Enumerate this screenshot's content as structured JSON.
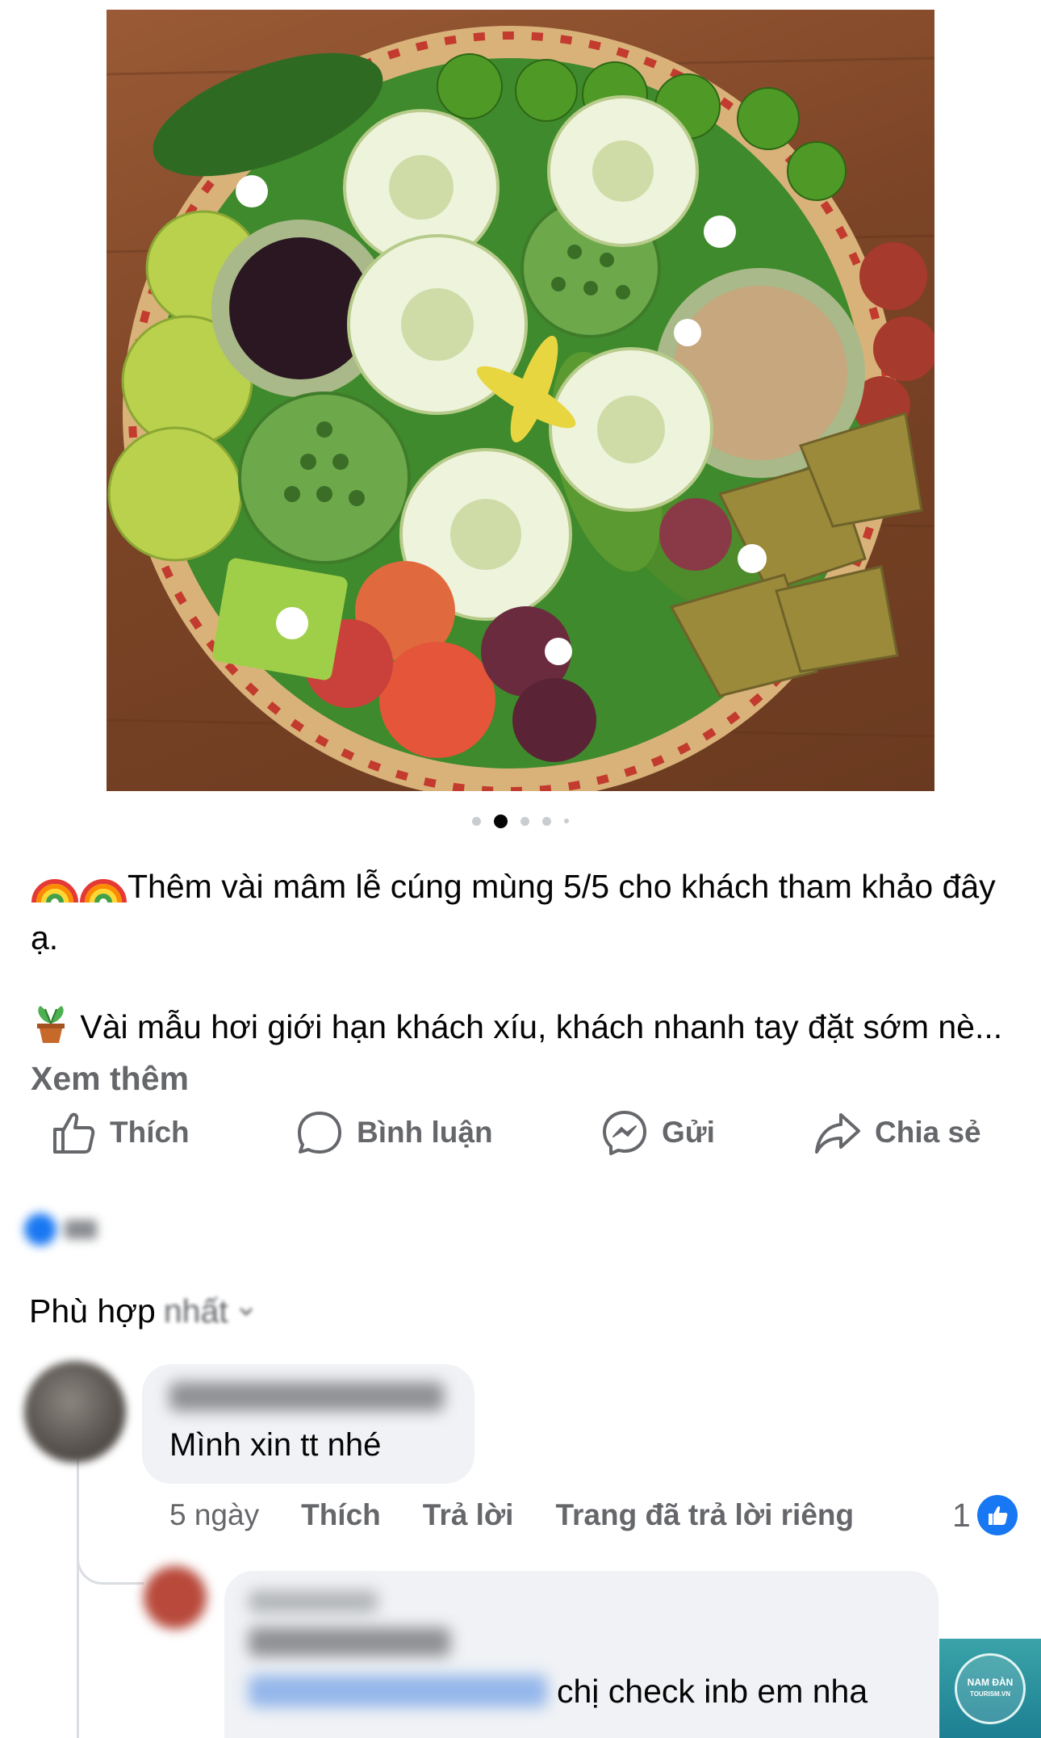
{
  "post": {
    "image_alt": "",
    "carousel": {
      "count": 5,
      "active_index": 1
    },
    "caption_line1": "Thêm vài mâm lễ cúng mùng 5/5 cho khách tham khảo đây ạ.",
    "caption_line2": "Vài mẫu hơi giới hạn khách xíu, khách nhanh tay đặt sớm nè...",
    "see_more": "Xem thêm",
    "emojis": [
      "rainbow",
      "rainbow",
      "potted-plant"
    ]
  },
  "actions": {
    "like": "Thích",
    "comment": "Bình luận",
    "send": "Gửi",
    "share": "Chia sẻ"
  },
  "sort": {
    "label_visible": "Phù hợp",
    "label_blurred": "nhất"
  },
  "comments": [
    {
      "text": "Mình xin tt nhé",
      "time": "5 ngày",
      "like": "Thích",
      "reply": "Trả lời",
      "page_replied": "Trang đã trả lời riêng",
      "reaction_count": "1"
    }
  ],
  "reply": {
    "text": "chị check inb em nha"
  },
  "logo": {
    "line1": "NAM ĐÀN",
    "line2": "TOURISM.VN"
  },
  "colors": {
    "accent": "#1877f2",
    "secondary_text": "#65676b",
    "bubble": "#f0f2f5"
  }
}
